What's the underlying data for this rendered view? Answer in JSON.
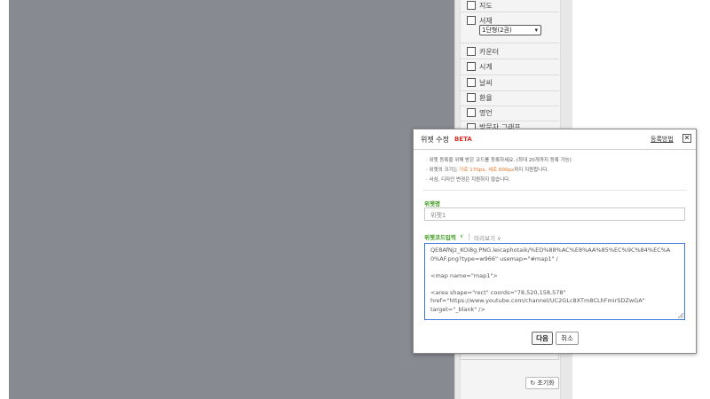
{
  "widget_panel": {
    "items": [
      {
        "label": "지도"
      },
      {
        "label": "서재"
      },
      {
        "label": "카운터"
      },
      {
        "label": "시계"
      },
      {
        "label": "날씨"
      },
      {
        "label": "환율"
      },
      {
        "label": "명언"
      },
      {
        "label": "방문자 그래프"
      }
    ],
    "shelf_select_value": "1단형(2권)",
    "reset_label": "초기화"
  },
  "dialog": {
    "title": "위젯 수정",
    "badge": "BETA",
    "help_link": "등록방법",
    "close_glyph": "✕",
    "info": {
      "line1": "· 위젯 등록을 위해 받은 코드를 등록하세요. (최대 20개까지 등록 가능)",
      "line2_prefix": "· 위젯의 크기는 ",
      "line2_highlight": "가로 170px, 세로 600px",
      "line2_suffix": "까지 지원합니다.",
      "line3": "· 서심, 디자인 변경은 지원하지 않습니다."
    },
    "name_section_label": "위젯명",
    "name_value": "위젯1",
    "code_tab_label": "위젯코드입력",
    "preview_tab_label": "미리보기",
    "code_lines": [
      "QE8AfNjz_KOi8g.PNG.leicaphotaik/%ED%88%AC%E8%AA%85%EC%9C%84%EC%A",
      "0%AF.png?type=w966\" usemap=\"#map1\" /",
      "",
      "<map name=\"map1\">",
      "",
      "<area shape=\"rect\" coords=\"78,520,158,578\"",
      "href=\"https://www.youtube.com/channel/UC2GLc8XTm8CLhFmirSDZwGA\"",
      "target=\"_blank\" />"
    ],
    "next_label": "다음",
    "cancel_label": "취소"
  }
}
